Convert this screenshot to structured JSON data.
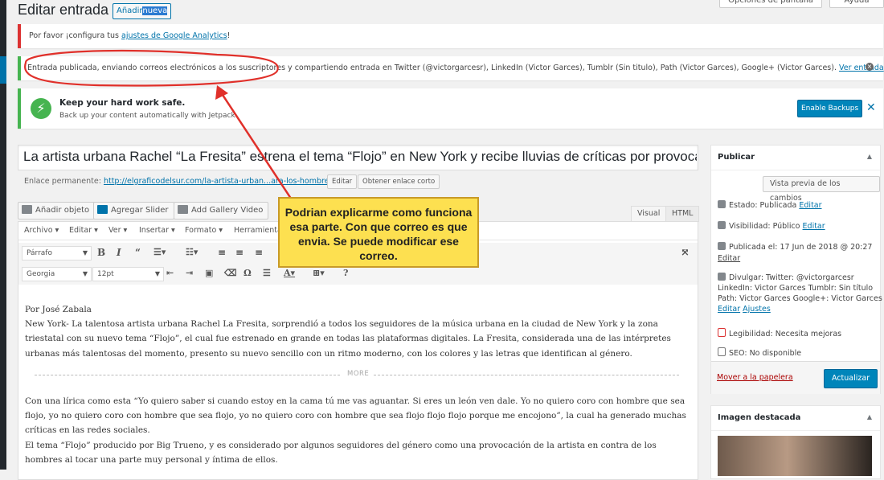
{
  "header": {
    "title": "Editar entrada",
    "add_new_part1": "Añadir",
    "add_new_part2": "nueva",
    "screen_options": "Opciones de pantalla",
    "help": "Ayuda"
  },
  "notices": {
    "analytics_text": "Por favor ¡configura tus ",
    "analytics_link": "ajustes de Google Analytics",
    "analytics_end": "!",
    "published_text": "Entrada publicada, enviando correos electrónicos a los suscriptores y compartiendo entrada en Twitter (@victorgarcesr), LinkedIn (Victor Garces), Tumblr (Sin titulo), Path (Victor Garces), Google+ (Victor Garces).",
    "published_link": "Ver entrada",
    "jetpack_title": "Keep your hard work safe.",
    "jetpack_sub": "Back up your content automatically with Jetpack.",
    "jetpack_button": "Enable Backups"
  },
  "post": {
    "title": "La artista urbana Rachel “La Fresita” estrena el tema “Flojo” en New York y recibe lluvias de críticas por provocar a l",
    "permalink_label": "Enlace permanente:",
    "permalink_url": "http://elgraficodelsur.com/la-artista-urban...ara-los-hombres/",
    "edit_button": "Editar",
    "shortlink_button": "Obtener enlace corto"
  },
  "media": {
    "add_object": "Añadir objeto",
    "slider": "Agregar Slider",
    "gallery": "Add Gallery Video",
    "tab_visual": "Visual",
    "tab_html": "HTML"
  },
  "editor_menu": [
    "Archivo ▾",
    "Editar ▾",
    "Ver ▾",
    "Insertar ▾",
    "Formato ▾",
    "Herramienta"
  ],
  "toolbar": {
    "format": "Párrafo",
    "font": "Georgia",
    "size": "12pt"
  },
  "content": {
    "p1": "Por José Zabala",
    "p2": "New York- La talentosa artista urbana Rachel La Fresita, sorprendió a todos los seguidores de la música urbana en la ciudad de New York y la zona triestatal con su nuevo tema “Flojo”, el cual fue estrenado en grande en todas las plataformas digitales. La Fresita, considerada una de las intérpretes urbanas más talentosas del momento, presento su nuevo sencillo con un ritmo moderno, con los colores y las letras que identifican al género.",
    "more": "MORE",
    "p3": "Con una lírica como esta “Yo quiero saber si cuando estoy en la cama tú me vas aguantar. Si eres un león ven dale. Yo no quiero coro con hombre que sea flojo, yo no quiero coro con hombre que sea flojo, yo no quiero coro con hombre que sea flojo flojo flojo porque me encojono”, la cual ha generado muchas críticas en las redes sociales.",
    "p4": "El tema “Flojo” producido por Big Trueno, y es considerado por algunos seguidores del género como una provocación de la artista en contra de los hombres al tocar una parte muy personal y íntima de ellos."
  },
  "annotation": {
    "text": "Podrian explicarme como funciona esa parte. Con que correo es que envia. Se puede modificar ese correo."
  },
  "publish": {
    "title": "Publicar",
    "preview": "Vista previa de los cambios",
    "status_label": "Estado: Publicada",
    "status_edit": "Editar",
    "visibility_label": "Visibilidad: Público",
    "visibility_edit": "Editar",
    "published_on": "Publicada el: 17 Jun de 2018 @ 20:27",
    "published_edit": "Editar",
    "share_l1": "Divulgar: Twitter: @victorgarcesr",
    "share_l2": "LinkedIn: Victor Garces Tumblr: Sin título",
    "share_l3": "Path: Victor Garces Google+: Victor Garces",
    "share_edit": "Editar",
    "share_settings": "Ajustes",
    "readability": "Legibilidad: Necesita mejoras",
    "seo": "SEO: No disponible",
    "trash": "Mover a la papelera",
    "update": "Actualizar"
  },
  "featured": {
    "title": "Imagen destacada"
  },
  "colors": {
    "accent": "#0073aa",
    "error": "#dc3232",
    "success": "#46b450",
    "callout": "#fde050",
    "arrow": "#e0302a"
  }
}
